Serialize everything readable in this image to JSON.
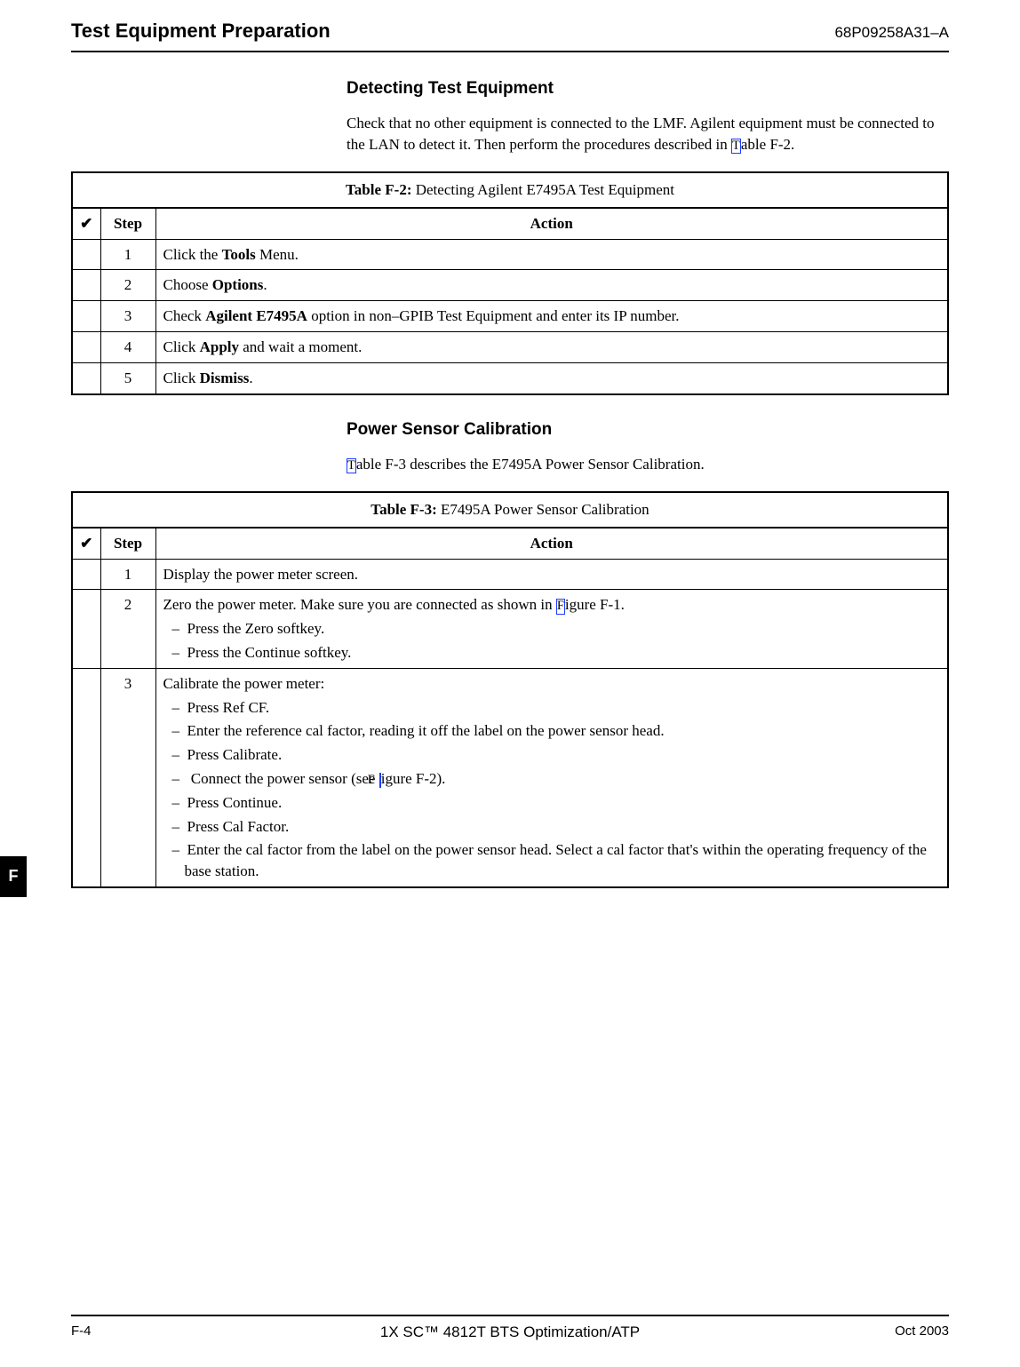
{
  "header": {
    "title": "Test Equipment Preparation",
    "docnum": "68P09258A31–A"
  },
  "section1": {
    "heading": "Detecting Test Equipment",
    "para_parts": {
      "p1": "Check that no other equipment is connected to the LMF. Agilent equipment must be connected to the LAN to detect it. Then perform the procedures described in ",
      "link1_left": "T",
      "p2": "able F-2."
    }
  },
  "tableF2": {
    "caption_label": "Table F-2:",
    "caption_text": " Detecting Agilent E7495A Test Equipment",
    "head_check": "✔",
    "head_step": "Step",
    "head_action": "Action",
    "rows": [
      {
        "step": "1",
        "prefix": "Click the ",
        "bold": "Tools",
        "suffix": " Menu."
      },
      {
        "step": "2",
        "prefix": "Choose ",
        "bold": "Options",
        "suffix": "."
      },
      {
        "step": "3",
        "prefix": "Check ",
        "bold": "Agilent E7495A",
        "suffix": " option in non–GPIB Test Equipment and enter its IP number."
      },
      {
        "step": "4",
        "prefix": "Click ",
        "bold": "Apply",
        "suffix": " and wait a moment."
      },
      {
        "step": "5",
        "prefix": "Click ",
        "bold": "Dismiss",
        "suffix": "."
      }
    ]
  },
  "section2": {
    "heading": "Power Sensor Calibration",
    "para_link1": "T",
    "para_rest": "able F-3 describes the E7495A Power Sensor Calibration."
  },
  "tableF3": {
    "caption_label": "Table F-3:",
    "caption_text": " E7495A Power Sensor Calibration",
    "head_check": "✔",
    "head_step": "Step",
    "head_action": "Action",
    "row1": {
      "step": "1",
      "text": "Display the power meter screen."
    },
    "row2": {
      "step": "2",
      "lead_pre": "Zero the power meter. Make sure you are connected as shown in ",
      "lead_link": "F",
      "lead_post": "igure F-1.",
      "sub1": "Press the Zero softkey.",
      "sub2": "Press the Continue softkey."
    },
    "row3": {
      "step": "3",
      "lead": "Calibrate the power meter:",
      "sub1": "Press Ref CF.",
      "sub2": "Enter the reference cal factor, reading it off the label on the power sensor head.",
      "sub3": "Press Calibrate.",
      "sub4_pre": "Connect the power sensor (see ",
      "sub4_link": "F",
      "sub4_post": "igure F-2).",
      "sub5": "Press Continue.",
      "sub6": "Press Cal Factor.",
      "sub7": "Enter the cal factor from the label on the power sensor  head. Select a cal factor that's within the operating frequency of the base station."
    }
  },
  "sidetab": "F",
  "footer": {
    "left": "F-4",
    "center": "1X SC™ 4812T BTS Optimization/ATP",
    "right": "Oct 2003"
  }
}
